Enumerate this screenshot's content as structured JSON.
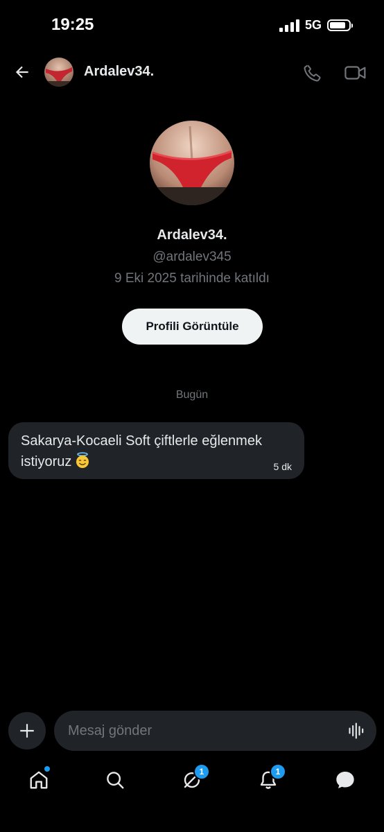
{
  "status_bar": {
    "time": "19:25",
    "network": "5G"
  },
  "header": {
    "name": "Ardalev34.",
    "icons": [
      "back-arrow-icon",
      "phone-icon",
      "video-camera-icon"
    ]
  },
  "profile": {
    "name": "Ardalev34.",
    "handle": "@ardalev345",
    "joined": "9 Eki 2025 tarihinde katıldı",
    "view_button_label": "Profili Görüntüle"
  },
  "conversation": {
    "date_divider": "Bugün",
    "messages": [
      {
        "text": "Sakarya-Kocaeli Soft çiftlerle eğlenmek istiyoruz",
        "emoji": "smiling-face-with-halo",
        "time": "5 dk"
      }
    ]
  },
  "composer": {
    "placeholder": "Mesaj gönder"
  },
  "bottom_nav": {
    "items": [
      {
        "icon": "home-icon",
        "dot": true
      },
      {
        "icon": "search-icon"
      },
      {
        "icon": "grok-icon",
        "badge": "1"
      },
      {
        "icon": "bell-icon",
        "badge": "1"
      },
      {
        "icon": "messages-icon",
        "active": true
      }
    ]
  },
  "colors": {
    "background": "#000000",
    "bubble": "#202327",
    "secondary_text": "#71767b",
    "accent": "#1d9bf0",
    "button_bg": "#eff3f4"
  }
}
